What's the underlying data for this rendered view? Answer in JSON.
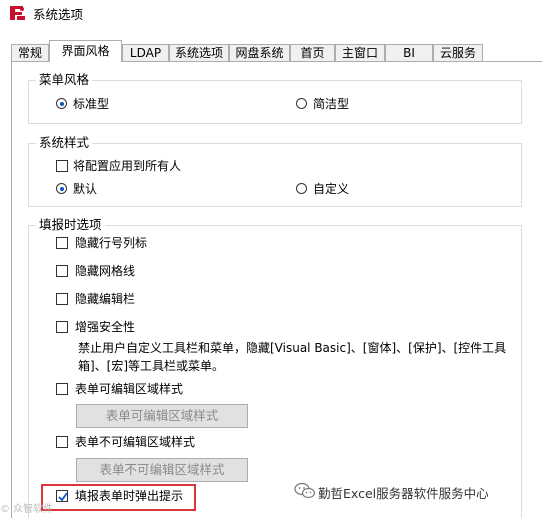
{
  "window": {
    "title": "系统选项"
  },
  "tabs": [
    {
      "label": "常规"
    },
    {
      "label": "界面风格"
    },
    {
      "label": "LDAP"
    },
    {
      "label": "系统选项"
    },
    {
      "label": "网盘系统"
    },
    {
      "label": "首页"
    },
    {
      "label": "主窗口"
    },
    {
      "label": "BI"
    },
    {
      "label": "云服务"
    }
  ],
  "active_tab": "界面风格",
  "menu_style": {
    "title": "菜单风格",
    "options": [
      {
        "label": "标准型",
        "selected": true
      },
      {
        "label": "简洁型",
        "selected": false
      }
    ]
  },
  "system_style": {
    "title": "系统样式",
    "apply_all": {
      "label": "将配置应用到所有人",
      "checked": false
    },
    "options": [
      {
        "label": "默认",
        "selected": true
      },
      {
        "label": "自定义",
        "selected": false
      }
    ]
  },
  "fill_options": {
    "title": "填报时选项",
    "hide_row_col": {
      "label": "隐藏行号列标",
      "checked": false
    },
    "hide_grid": {
      "label": "隐藏网格线",
      "checked": false
    },
    "hide_edit_bar": {
      "label": "隐藏编辑栏",
      "checked": false
    },
    "enhance_security": {
      "label": "增强安全性",
      "checked": false
    },
    "security_desc": "禁止用户自定义工具栏和菜单，隐藏[Visual Basic]、[窗体]、[保护]、[控件工具箱]、[宏]等工具栏或菜单。",
    "editable_style": {
      "label": "表单可编辑区域样式",
      "checked": false,
      "button": "表单可编辑区域样式"
    },
    "non_editable_style": {
      "label": "表单不可编辑区域样式",
      "checked": false,
      "button": "表单不可编辑区域样式"
    },
    "popup_tip": {
      "label": "填报表单时弹出提示",
      "checked": true
    }
  },
  "watermark": {
    "right": "勤哲Excel服务器软件服务中心",
    "left": "© 众智软件"
  },
  "colors": {
    "highlight": "#d9373d",
    "accent": "#0a55c4"
  }
}
